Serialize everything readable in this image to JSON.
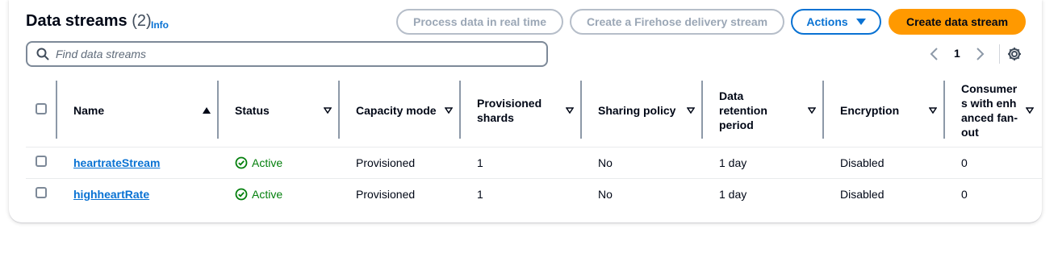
{
  "header": {
    "title": "Data streams",
    "count": "(2)",
    "info": "Info"
  },
  "buttons": {
    "process_realtime": "Process data in real time",
    "create_firehose": "Create a Firehose delivery stream",
    "actions": "Actions",
    "create_stream": "Create data stream"
  },
  "search": {
    "placeholder": "Find data streams",
    "value": ""
  },
  "pagination": {
    "current_page": "1"
  },
  "colors": {
    "link": "#0972d3",
    "active": "#037f0c",
    "primary": "#ff9900",
    "disabled": "#9ba7b6"
  },
  "table": {
    "columns": [
      {
        "label": "Name",
        "sort": "ascending"
      },
      {
        "label": "Status",
        "sort": "none"
      },
      {
        "label": "Capacity mode",
        "sort": "none"
      },
      {
        "label": "Provisioned shards",
        "sort": "none"
      },
      {
        "label": "Sharing policy",
        "sort": "none"
      },
      {
        "label": "Data retention period",
        "sort": "none"
      },
      {
        "label": "Encryption",
        "sort": "none"
      },
      {
        "label": "Consumers with enhanced fan-out",
        "sort": "none"
      }
    ],
    "rows": [
      {
        "name": "heartrateStream",
        "status": "Active",
        "capacity_mode": "Provisioned",
        "shards": "1",
        "sharing_policy": "No",
        "retention": "1 day",
        "encryption": "Disabled",
        "consumers": "0"
      },
      {
        "name": "highheartRate",
        "status": "Active",
        "capacity_mode": "Provisioned",
        "shards": "1",
        "sharing_policy": "No",
        "retention": "1 day",
        "encryption": "Disabled",
        "consumers": "0"
      }
    ]
  }
}
